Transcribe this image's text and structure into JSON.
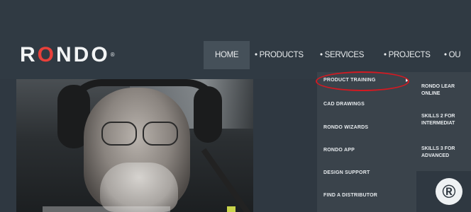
{
  "brand": {
    "logo_pre": "R",
    "logo_o": "O",
    "logo_post": "NDO",
    "logo_reg": "®"
  },
  "nav": {
    "items": [
      {
        "label": "HOME"
      },
      {
        "label": "• PRODUCTS"
      },
      {
        "label": "• SERVICES"
      },
      {
        "label": "• PROJECTS"
      },
      {
        "label": "• OU"
      }
    ]
  },
  "services_menu": {
    "items": [
      {
        "label": "PRODUCT TRAINING"
      },
      {
        "label": "CAD DRAWINGS"
      },
      {
        "label": "RONDO WIZARDS"
      },
      {
        "label": "RONDO APP"
      },
      {
        "label": "DESIGN SUPPORT"
      },
      {
        "label": "FIND A DISTRIBUTOR"
      }
    ],
    "arrow": "▸"
  },
  "training_submenu": {
    "items": [
      {
        "line1": "RONDO LEAR",
        "line2": "ONLINE"
      },
      {
        "line1": "SKILLS 2 FOR",
        "line2": "INTERMEDIAT"
      },
      {
        "line1": "SKILLS 3 FOR",
        "line2": "ADVANCED"
      }
    ]
  },
  "badge": {
    "symbol": "®"
  },
  "colors": {
    "accent_red": "#d21a22",
    "nav_bg": "#303a43",
    "menu_bg": "#3a434b"
  }
}
